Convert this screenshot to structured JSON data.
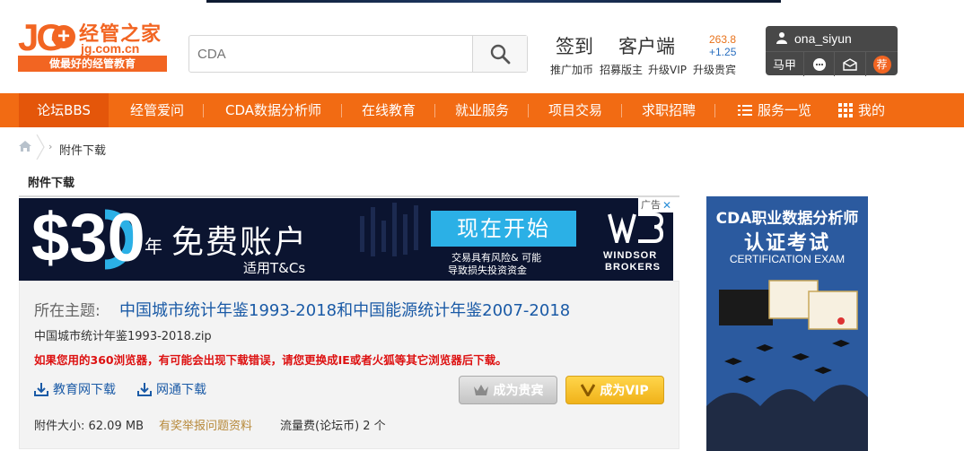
{
  "logo": {
    "mark": "JG",
    "name": "经管之家",
    "url": "jg.com.cn",
    "slogan": "做最好的经管教育"
  },
  "search": {
    "placeholder": "CDA"
  },
  "header": {
    "signin": "签到",
    "client": "客户端",
    "links": [
      "推广加币",
      "招募版主",
      "升级VIP",
      "升级贵宾"
    ],
    "stat_primary": "263.8",
    "stat_delta": "+1.25"
  },
  "user": {
    "name": "ona_siyun",
    "coin_label": "马甲",
    "recommend_badge": "荐"
  },
  "nav": {
    "items": [
      "论坛BBS",
      "经管爱问",
      "CDA数据分析师",
      "在线教育",
      "就业服务",
      "项目交易",
      "求职招聘",
      "服务一览",
      "我的"
    ],
    "active": "论坛BBS"
  },
  "breadcrumb": {
    "current": "附件下载"
  },
  "section_title": "附件下载",
  "ad_banner": {
    "amount": "$30",
    "unit": "年",
    "headline": "免费账户",
    "terms": "适用T&Cs",
    "cta": "现在开始",
    "risk_line1": "交易具有风险& 可能",
    "risk_line2": "导致损失投资资金",
    "brand_line1": "WINDSOR",
    "brand_line2": "BROKERS",
    "badge": "广告"
  },
  "attachment": {
    "topic_label": "所在主题:",
    "topic_title": "中国城市统计年鉴1993-2018和中国能源统计年鉴2007-2018",
    "filename": "中国城市统计年鉴1993-2018.zip",
    "warning": "如果您用的360浏览器，有可能会出现下载错误，请您更换成IE或者火狐等其它浏览器后下载。",
    "download_edu": "教育网下载",
    "download_net": "网通下载",
    "btn_guest": "成为贵宾",
    "btn_vip": "成为VIP",
    "size": "附件大小: 62.09 MB",
    "report": "有奖举报问题资料",
    "fee": "流量费(论坛币) 2 个"
  },
  "side_ad": {
    "title1": "CDA职业数据分析师",
    "title2": "认证考试",
    "subtitle": "CERTIFICATION EXAM"
  },
  "colors": {
    "brand_orange": "#f26b13",
    "link_blue": "#1a5aa6",
    "warning_red": "#dd1111"
  }
}
